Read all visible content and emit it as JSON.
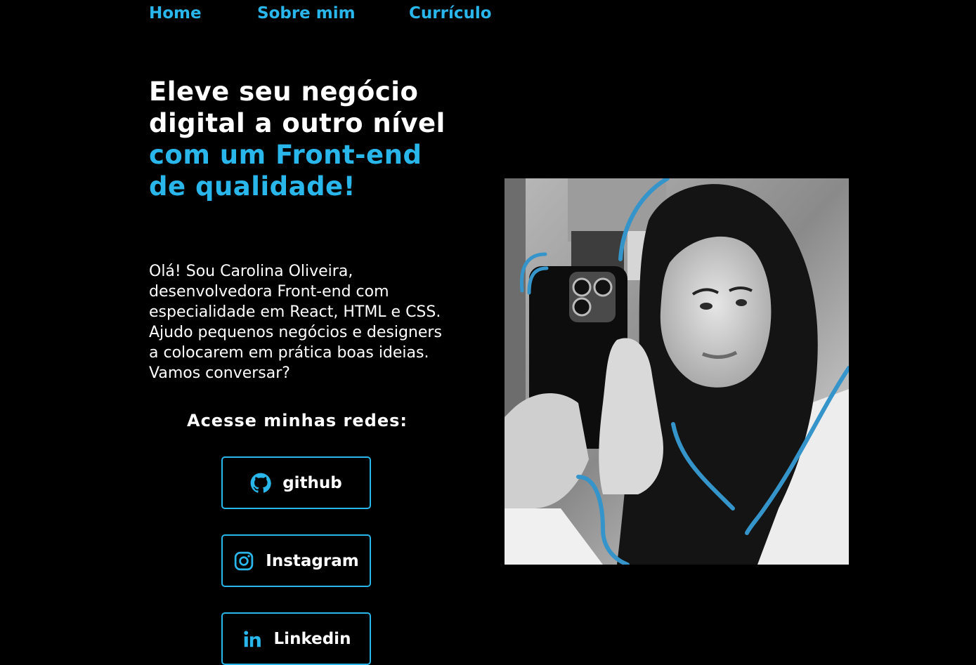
{
  "nav": {
    "home": "Home",
    "sobre": "Sobre mim",
    "curriculo": "Currículo"
  },
  "hero": {
    "headline_white": "Eleve seu negócio digital a outro nível ",
    "headline_accent": "com um Front-end de qualidade!",
    "intro": "Olá! Sou Carolina Oliveira, desenvolvedora Front-end com especialidade em React, HTML e CSS. Ajudo pequenos negócios e designers a colocarem em prática boas ideias. Vamos conversar?"
  },
  "social": {
    "title": "Acesse minhas redes:",
    "github": "github",
    "instagram": "Instagram",
    "linkedin": "Linkedin"
  },
  "photo": {
    "icon": "profile-photo"
  },
  "colors": {
    "background": "#000000",
    "accent": "#29b6ea",
    "text": "#ffffff"
  }
}
